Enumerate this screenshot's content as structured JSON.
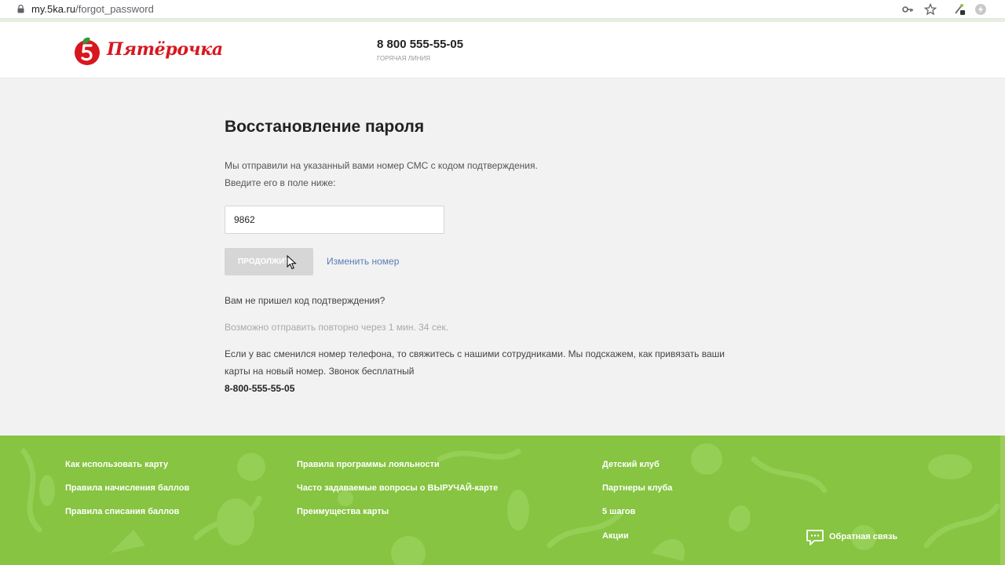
{
  "browser": {
    "url_host": "my.5ka.ru",
    "url_path": "/forgot_password"
  },
  "header": {
    "logo_text": "Пятёрочка",
    "hotline_phone": "8 800 555-55-05",
    "hotline_label": "ГОРЯЧАЯ ЛИНИЯ"
  },
  "main": {
    "title": "Восстановление пароля",
    "instruction_line1": "Мы отправили на указанный вами номер СМС с кодом подтверждения.",
    "instruction_line2": "Введите его в поле ниже:",
    "code_value": "9862",
    "continue_label": "Продолжить",
    "change_number_label": "Изменить номер",
    "no_code_question": "Вам не пришел код подтверждения?",
    "resend_text": "Возможно отправить повторно через 1 мин. 34 сек.",
    "changed_number_line1": "Если у вас сменился номер телефона, то свяжитесь с нашими сотрудниками. Мы подскажем, как привязать ваши",
    "changed_number_line2": "карты на новый номер. Звонок бесплатный",
    "contact_phone": "8-800-555-55-05"
  },
  "footer": {
    "col1": [
      "Как использовать карту",
      "Правила начисления баллов",
      "Правила списания баллов"
    ],
    "col2": [
      "Правила программы лояльности",
      "Часто задаваемые вопросы о ВЫРУЧАЙ-карте",
      "Преимущества карты"
    ],
    "col3": [
      "Детский клуб",
      "Партнеры клуба",
      "5 шагов",
      "Акции"
    ],
    "feedback_label": "Обратная связь"
  },
  "colors": {
    "brand_red": "#d7171f",
    "footer_green": "#86c441",
    "link_blue": "#5a7db6",
    "button_disabled": "#d6d6d6"
  },
  "icons": [
    "lock-icon",
    "key-icon",
    "star-icon",
    "extension-icon",
    "shield-icon",
    "cursor-icon",
    "chat-icon"
  ]
}
